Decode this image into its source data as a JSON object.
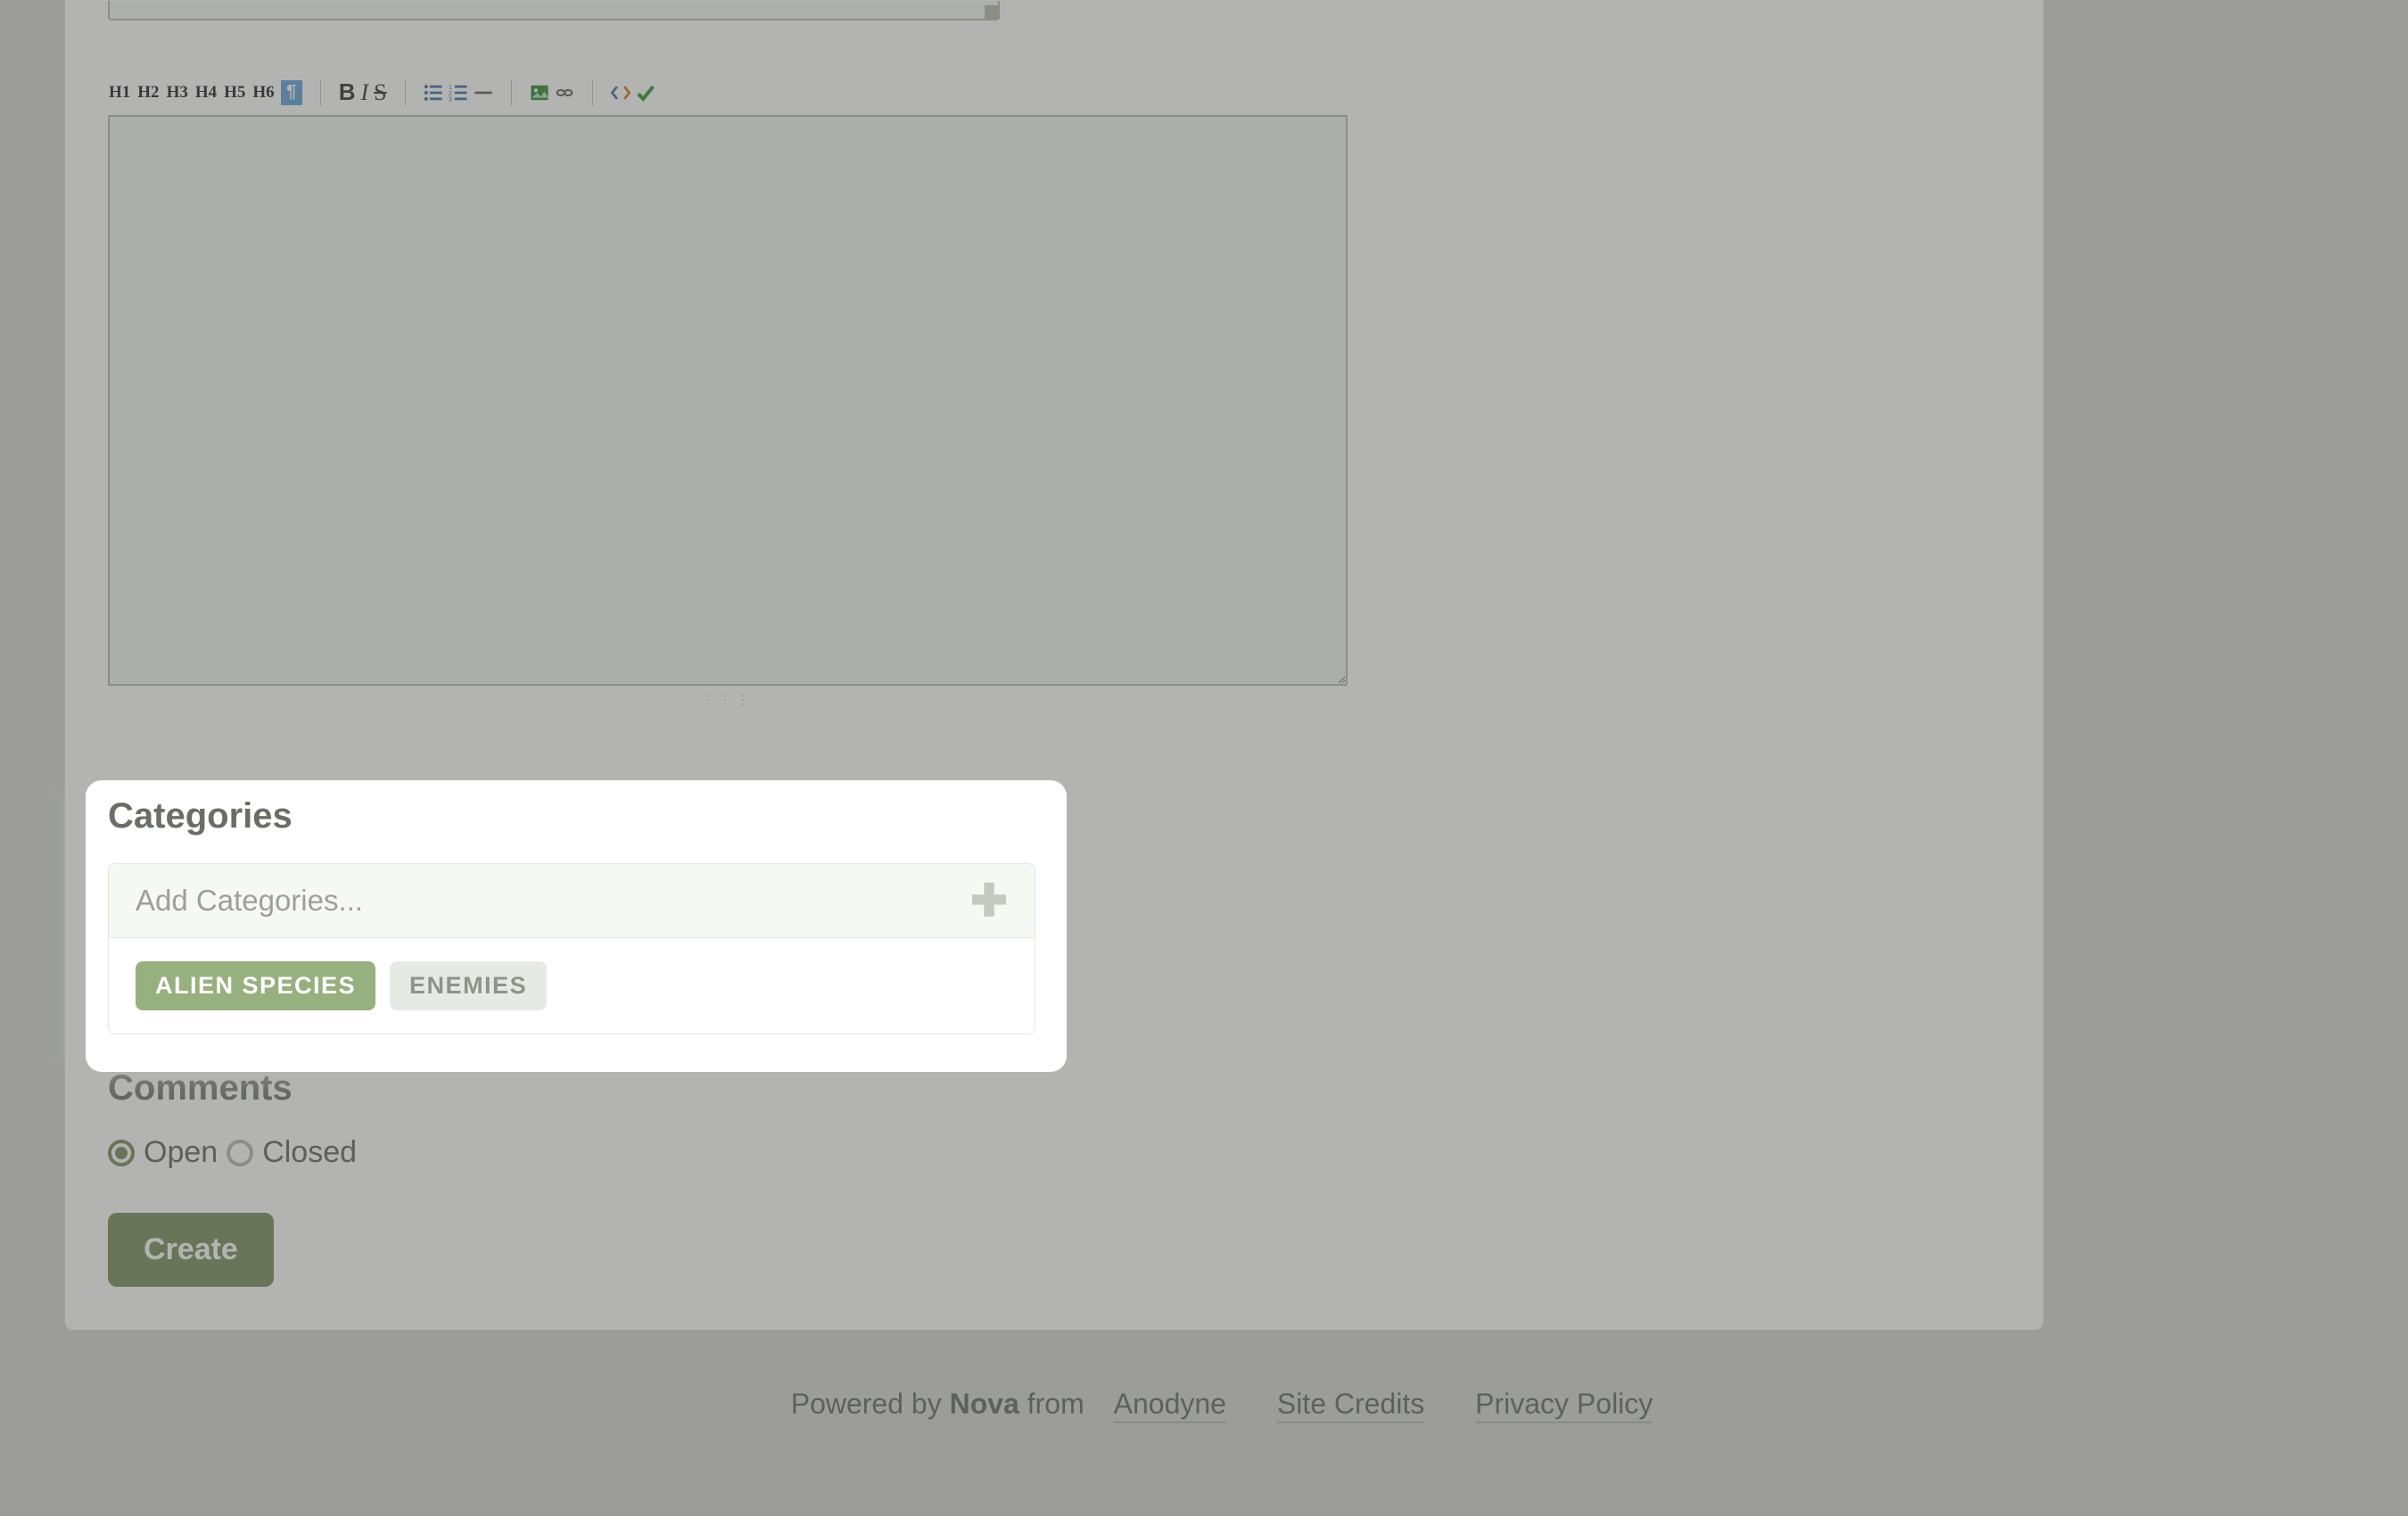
{
  "toolbar": {
    "headings": [
      "H1",
      "H2",
      "H3",
      "H4",
      "H5",
      "H6"
    ]
  },
  "categories": {
    "title": "Categories",
    "placeholder": "Add Categories...",
    "tags": [
      {
        "label": "ALIEN SPECIES",
        "active": true
      },
      {
        "label": "ENEMIES",
        "active": false
      }
    ]
  },
  "comments": {
    "title": "Comments",
    "options": [
      {
        "label": "Open",
        "checked": true
      },
      {
        "label": "Closed",
        "checked": false
      }
    ]
  },
  "submit": {
    "label": "Create"
  },
  "footer": {
    "powered_by_prefix": "Powered by ",
    "powered_by_product": "Nova",
    "powered_by_middle": " from ",
    "anodyne": "Anodyne",
    "site_credits": "Site Credits",
    "privacy": "Privacy Policy"
  }
}
